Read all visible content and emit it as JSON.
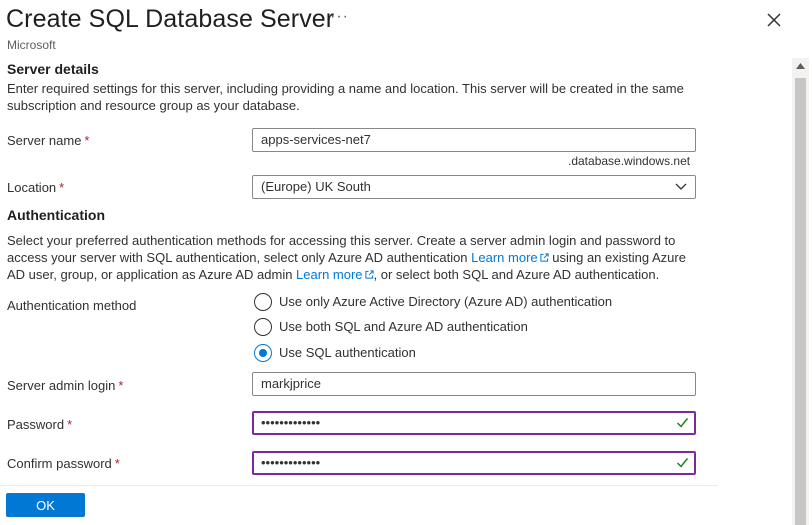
{
  "header": {
    "title": "Create SQL Database Server",
    "more_label": "···",
    "subtitle": "Microsoft"
  },
  "server_details": {
    "heading": "Server details",
    "description": "Enter required settings for this server, including providing a name and location. This server will be created in the same subscription and resource group as your database."
  },
  "fields": {
    "server_name_label": "Server name",
    "server_name_value": "apps-services-net7",
    "server_name_suffix": ".database.windows.net",
    "location_label": "Location",
    "location_value": "(Europe) UK South",
    "required_mark": "*"
  },
  "authentication": {
    "heading": "Authentication",
    "desc_part1": "Select your preferred authentication methods for accessing this server. Create a server admin login and password to access your server with SQL authentication, select only Azure AD authentication ",
    "learn_more_1": "Learn more",
    "desc_part2": " using an existing Azure AD user, group, or application as Azure AD admin ",
    "learn_more_2": "Learn more",
    "desc_part3": ", or select both SQL and Azure AD authentication.",
    "method_label": "Authentication method",
    "options": [
      {
        "label": "Use only Azure Active Directory (Azure AD) authentication",
        "selected": false
      },
      {
        "label": "Use both SQL and Azure AD authentication",
        "selected": false
      },
      {
        "label": "Use SQL authentication",
        "selected": true
      }
    ]
  },
  "credentials": {
    "admin_login_label": "Server admin login",
    "admin_login_value": "markjprice",
    "password_label": "Password",
    "password_value": "•••••••••••••",
    "confirm_label": "Confirm password",
    "confirm_value": "•••••••••••••"
  },
  "footer": {
    "ok_label": "OK"
  },
  "colors": {
    "accent": "#0078d4",
    "required": "#a4262c",
    "valid_border": "#7a2aa0",
    "valid_check": "#107c10"
  }
}
